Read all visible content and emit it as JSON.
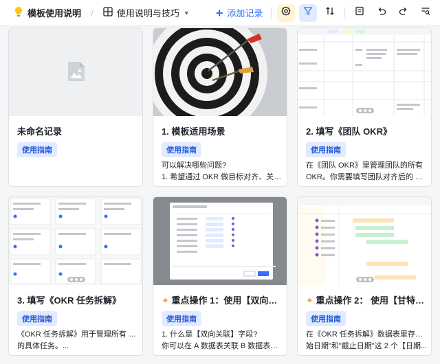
{
  "toolbar": {
    "doc_title": "模板使用说明",
    "view_name": "使用说明与技巧",
    "add_record": "添加记录"
  },
  "cards": [
    {
      "title": "未命名记录",
      "tag": "使用指南",
      "desc": []
    },
    {
      "title": "1. 模板适用场景",
      "tag": "使用指南",
      "desc": [
        "可以解决哪些问题?",
        "1. 希望通过 OKR 做目标对齐、关键..."
      ]
    },
    {
      "title": "2. 填写《团队 OKR》",
      "tag": "使用指南",
      "desc": [
        "在《团队 OKR》里管理团队的所有",
        "OKR。你需要填写团队对齐后的 O（..."
      ]
    },
    {
      "title": "3. 填写《OKR 任务拆解》",
      "tag": "使用指南",
      "desc": [
        "《OKR 任务拆解》用于管理所有 KR 下",
        "的具体任务。..."
      ]
    },
    {
      "title": "重点操作 1：使用【双向关...",
      "tag": "使用指南",
      "desc": [
        "1. 什么是【双向关联】字段?",
        "你可以在 A 数据表关联 B 数据表的一..."
      ]
    },
    {
      "title": "重点操作 2： 使用【甘特视...",
      "tag": "使用指南",
      "desc": [
        "在《OKR 任务拆解》数据表里存在\"开",
        "始日期\"和\"截止日期\"这 2 个【日期..."
      ]
    }
  ],
  "colors": {
    "accent": "#3370ff",
    "tag_bg": "#e1eaff",
    "tag_text": "#245bdb"
  }
}
